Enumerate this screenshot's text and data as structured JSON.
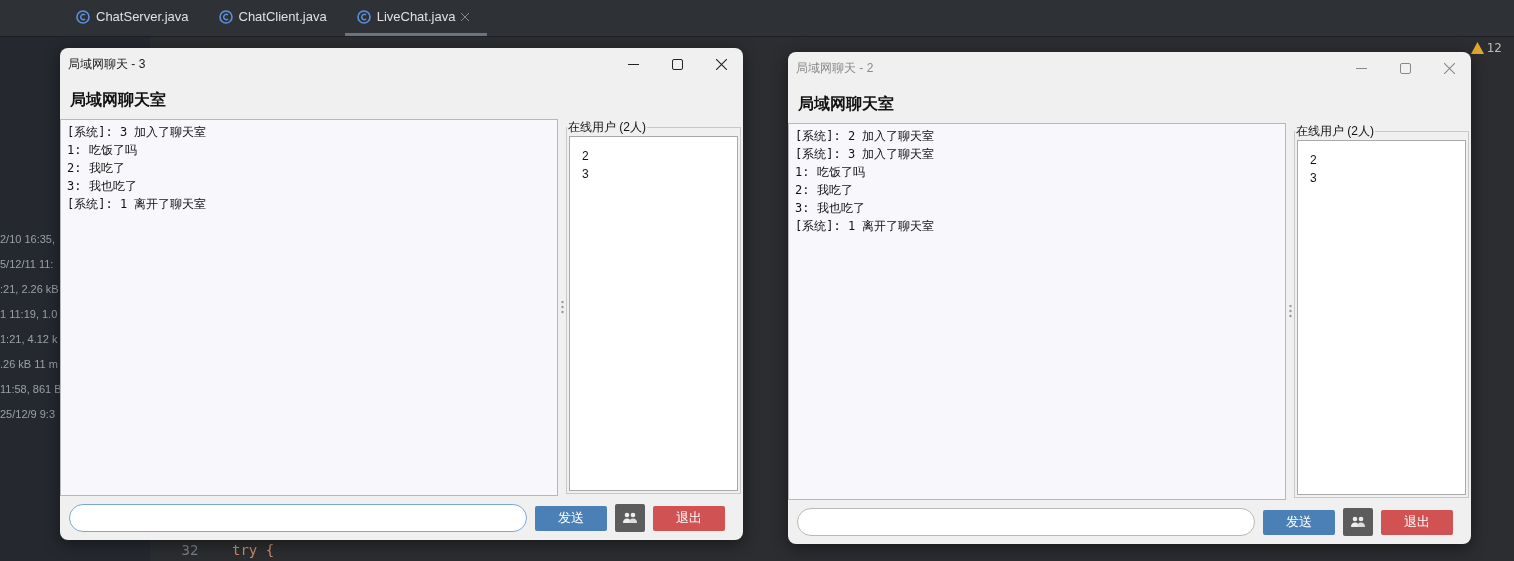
{
  "ide": {
    "tabs": [
      {
        "label": "ChatServer.java",
        "selected": false
      },
      {
        "label": "ChatClient.java",
        "selected": false
      },
      {
        "label": "LiveChat.java",
        "selected": true
      }
    ],
    "warning_count": "12",
    "side_items": [
      "2/10 16:35,",
      "5/12/11 11:",
      ":21, 2.26 kB",
      "1 11:19, 1.0",
      "1:21, 4.12 k",
      ".26 kB 11 m",
      "11:58, 861 B",
      "25/12/9 9:3"
    ],
    "bottom_line": {
      "number": "32",
      "code": "try {"
    }
  },
  "windows": [
    {
      "title": "局域网聊天 - 3",
      "active": true,
      "heading": "局域网聊天室",
      "messages": [
        "[系统]: 3 加入了聊天室",
        "1: 吃饭了吗",
        "2: 我吃了",
        "3: 我也吃了",
        "[系统]: 1 离开了聊天室"
      ],
      "users_panel": {
        "title": "在线用户 (2人)",
        "users": [
          "2",
          "3"
        ]
      },
      "input": {
        "focused": true
      },
      "send": "发送",
      "exit": "退出"
    },
    {
      "title": "局域网聊天 - 2",
      "active": false,
      "heading": "局域网聊天室",
      "messages": [
        "[系统]: 2 加入了聊天室",
        "[系统]: 3 加入了聊天室",
        "1: 吃饭了吗",
        "2: 我吃了",
        "3: 我也吃了",
        "[系统]: 1 离开了聊天室"
      ],
      "users_panel": {
        "title": "在线用户 (2人)",
        "users": [
          "2",
          "3"
        ]
      },
      "input": {
        "focused": false
      },
      "send": "发送",
      "exit": "退出"
    }
  ]
}
